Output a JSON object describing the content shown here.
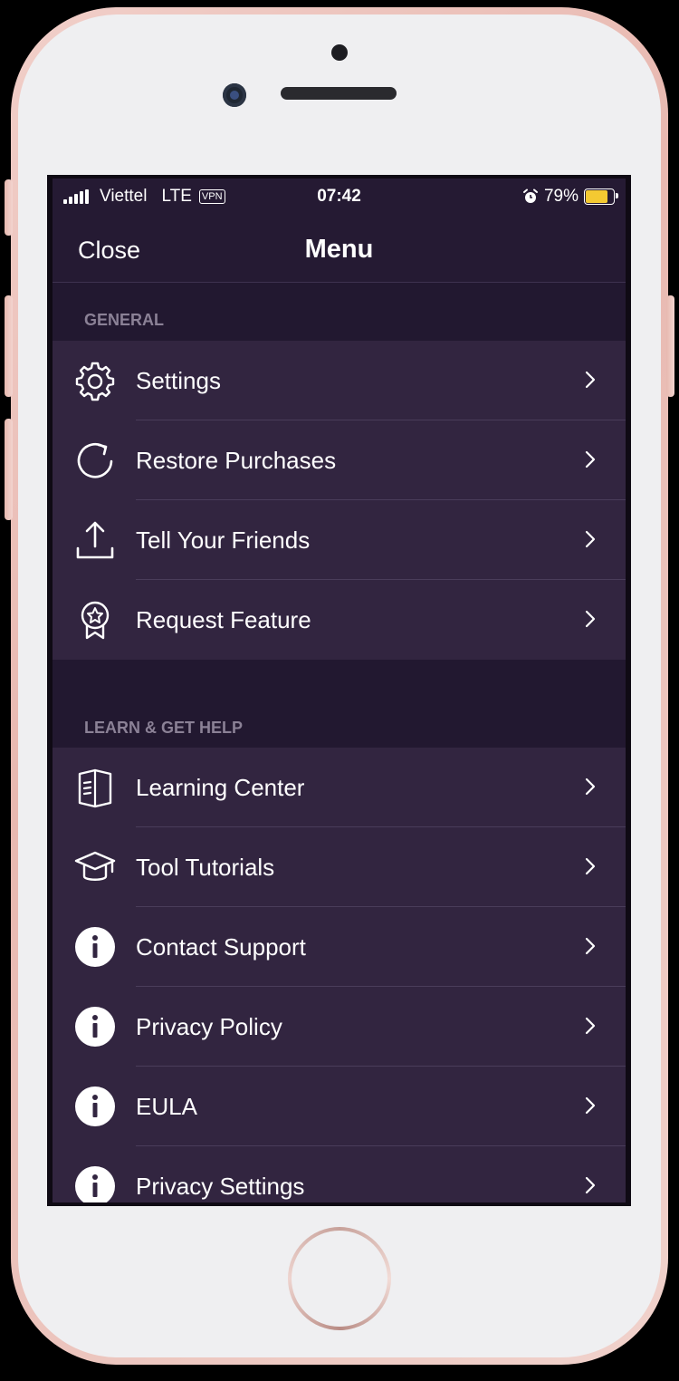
{
  "status_bar": {
    "carrier": "Viettel",
    "network": "LTE",
    "vpn": "VPN",
    "time": "07:42",
    "battery_percent": "79%",
    "battery_level": 0.79,
    "battery_color": "#f4c932"
  },
  "nav": {
    "close_label": "Close",
    "title": "Menu"
  },
  "sections": {
    "general": {
      "title": "GENERAL",
      "items": [
        {
          "label": "Settings",
          "icon": "gear-icon"
        },
        {
          "label": "Restore Purchases",
          "icon": "refresh-icon"
        },
        {
          "label": "Tell Your Friends",
          "icon": "share-icon"
        },
        {
          "label": "Request Feature",
          "icon": "award-badge-icon"
        }
      ]
    },
    "learn": {
      "title": "LEARN & GET HELP",
      "items": [
        {
          "label": "Learning Center",
          "icon": "book-icon"
        },
        {
          "label": "Tool Tutorials",
          "icon": "graduation-cap-icon"
        },
        {
          "label": "Contact Support",
          "icon": "info-icon"
        },
        {
          "label": "Privacy Policy",
          "icon": "info-icon"
        },
        {
          "label": "EULA",
          "icon": "info-icon"
        },
        {
          "label": "Privacy Settings",
          "icon": "info-icon"
        }
      ]
    }
  },
  "colors": {
    "background": "#2f2340",
    "row": "#322540",
    "section_header": "#221830",
    "text": "#ffffff",
    "section_text": "#8b8196"
  }
}
